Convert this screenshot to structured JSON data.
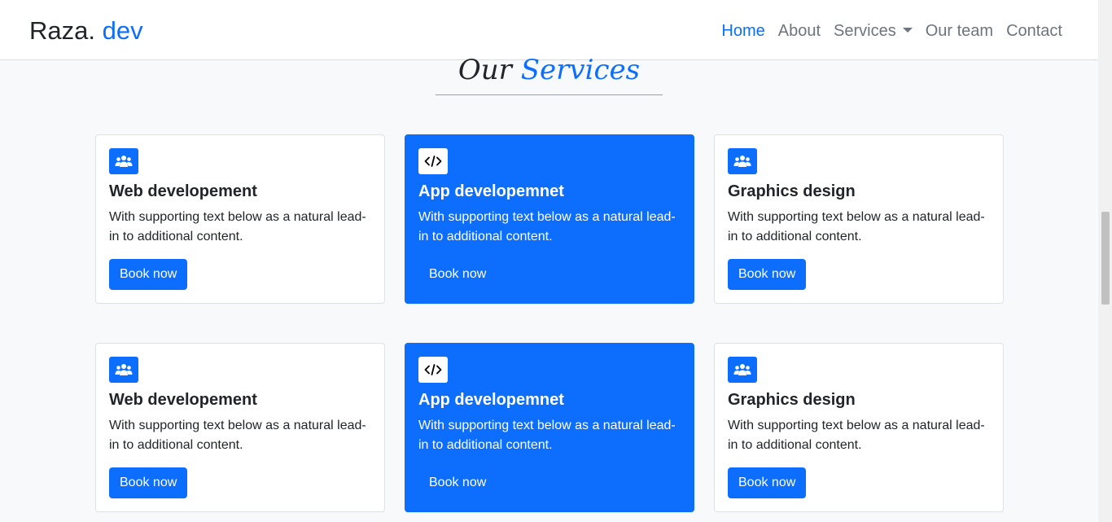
{
  "nav": {
    "brand": "Raza.",
    "brand_accent": " dev",
    "links": [
      "Home",
      "About",
      "Services",
      "Our team",
      "Contact"
    ],
    "active": "Home"
  },
  "section": {
    "title": "Our",
    "title_accent": " Services"
  },
  "cards": [
    {
      "icon": "users-icon",
      "title": "Web developement",
      "text": "With supporting text below as a natural lead-in to additional content.",
      "button": "Book now",
      "highlight": false
    },
    {
      "icon": "code-icon",
      "title": "App developemnet",
      "text": "With supporting text below as a natural lead-in to additional content.",
      "button": "Book now",
      "highlight": true
    },
    {
      "icon": "users-icon",
      "title": "Graphics design",
      "text": "With supporting text below as a natural lead-in to additional content.",
      "button": "Book now",
      "highlight": false
    },
    {
      "icon": "users-icon",
      "title": "Web developement",
      "text": "With supporting text below as a natural lead-in to additional content.",
      "button": "Book now",
      "highlight": false
    },
    {
      "icon": "code-icon",
      "title": "App developemnet",
      "text": "With supporting text below as a natural lead-in to additional content.",
      "button": "Book now",
      "highlight": true
    },
    {
      "icon": "users-icon",
      "title": "Graphics design",
      "text": "With supporting text below as a natural lead-in to additional content.",
      "button": "Book now",
      "highlight": false
    }
  ],
  "colors": {
    "primary": "#0d6efd",
    "background": "#f8f9fa"
  }
}
